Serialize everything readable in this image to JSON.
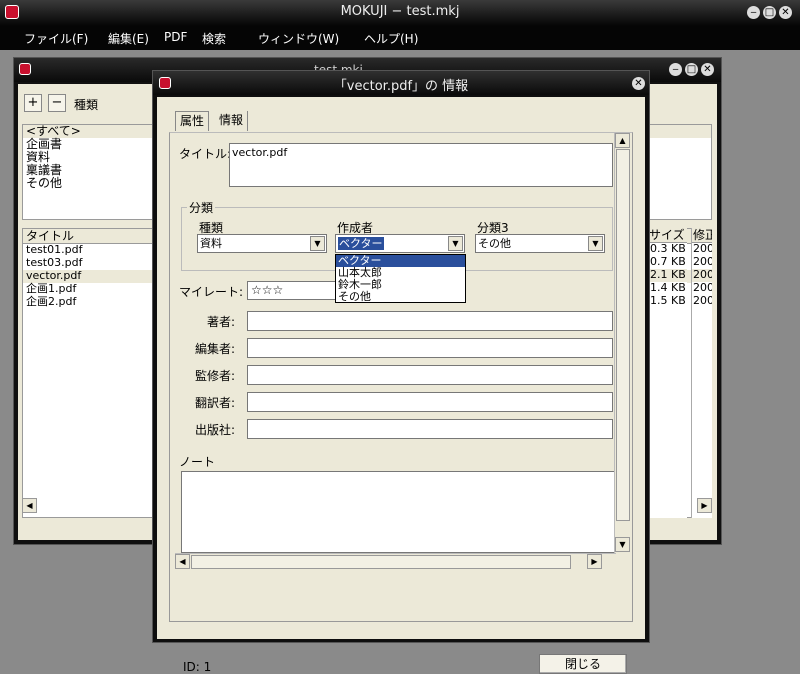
{
  "main_window": {
    "title": "MOKUJI − test.mkj"
  },
  "menu": [
    {
      "label": "ファイル(F)"
    },
    {
      "label": "編集(E)"
    },
    {
      "label": "PDF"
    },
    {
      "label": "検索"
    },
    {
      "label": "ウィンドウ(W)"
    },
    {
      "label": "ヘルプ(H)"
    }
  ],
  "back_window": {
    "title": "test.mkj",
    "add_label": "+",
    "remove_label": "−",
    "category_header": "種類",
    "categories": [
      "<すべて>",
      "企画書",
      "資料",
      "稟議書",
      "その他"
    ],
    "file_header": "タイトル",
    "files": [
      "test01.pdf",
      "test03.pdf",
      "vector.pdf",
      "企画1.pdf",
      "企画2.pdf"
    ],
    "size_header": "サイズ",
    "modified_header": "修正",
    "sizes": [
      "0.3 KB",
      "0.7 KB",
      "2.1 KB",
      "1.4 KB",
      "1.5 KB"
    ],
    "modified": [
      "200",
      "200",
      "200",
      "200",
      "200"
    ]
  },
  "dialog": {
    "title": "「vector.pdf」の 情報",
    "tabs": [
      "属性",
      "情報"
    ],
    "title_label": "タイトル:",
    "title_value": "vector.pdf",
    "group_label": "分類",
    "category1_label": "種類",
    "category1_value": "資料",
    "category2_label": "作成者",
    "category2_value": "ベクター",
    "category3_label": "分類3",
    "category3_value": "その他",
    "dropdown_options": [
      "ベクター",
      "山本太郎",
      "鈴木一郎",
      "その他"
    ],
    "rating_label": "マイレート:",
    "rating_value": "☆☆☆",
    "author_label": "著者:",
    "editor_label": "編集者:",
    "supervisor_label": "監修者:",
    "translator_label": "翻訳者:",
    "publisher_label": "出版社:",
    "note_label": "ノート",
    "id_label": "ID: 1",
    "close_label": "閉じる"
  },
  "colors": {
    "accent": "#2a4f9c",
    "panel": "#ece9d8",
    "titlebar": "#0a0a0a",
    "app_icon": "#c8102e"
  }
}
